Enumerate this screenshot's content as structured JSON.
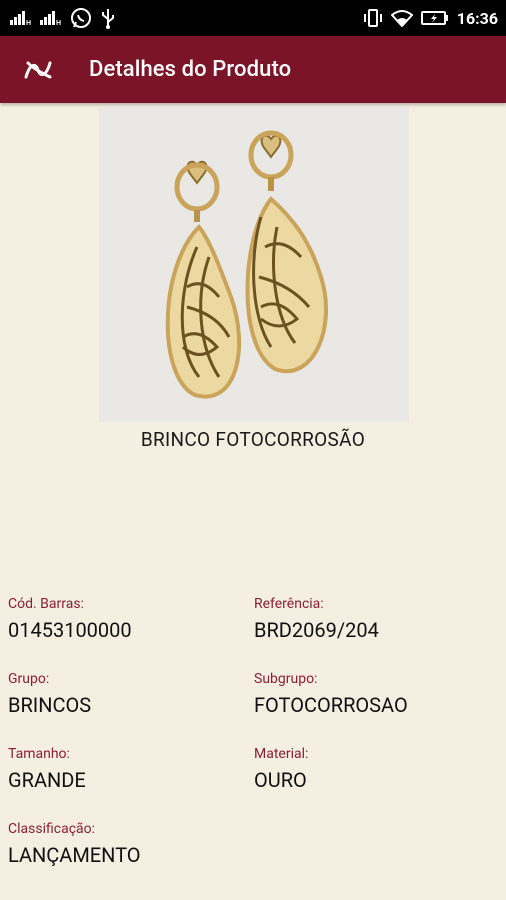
{
  "status_bar": {
    "time": "16:36",
    "icons": [
      "signal-icon",
      "signal-icon",
      "whatsapp-icon",
      "usb-icon",
      "vibrate-icon",
      "wifi-icon",
      "battery-icon"
    ]
  },
  "app_bar": {
    "title": "Detalhes do Produto",
    "logo_icon": "brand-logo-icon"
  },
  "colors": {
    "accent": "#7b1427",
    "background": "#f5efe2",
    "label": "#8a1f33"
  },
  "product": {
    "image_icon": "earrings-image",
    "name": "BRINCO FOTOCORROSÃO"
  },
  "details": {
    "barcode_label": "Cód. Barras:",
    "barcode_value": "01453100000",
    "reference_label": "Referência:",
    "reference_value": "BRD2069/204",
    "group_label": "Grupo:",
    "group_value": "BRINCOS",
    "subgroup_label": "Subgrupo:",
    "subgroup_value": "FOTOCORROSAO",
    "size_label": "Tamanho:",
    "size_value": "GRANDE",
    "material_label": "Material:",
    "material_value": "OURO",
    "classification_label": "Classificação:",
    "classification_value": "LANÇAMENTO"
  }
}
